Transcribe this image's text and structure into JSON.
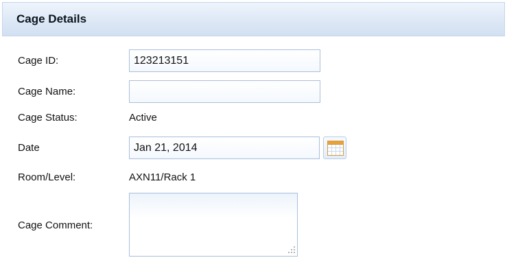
{
  "panel": {
    "title": "Cage Details"
  },
  "form": {
    "cage_id": {
      "label": "Cage ID:",
      "value": "123213151"
    },
    "cage_name": {
      "label": "Cage Name:",
      "value": ""
    },
    "cage_status": {
      "label": "Cage Status:",
      "value": "Active"
    },
    "date": {
      "label": "Date",
      "value": "Jan 21, 2014",
      "picker_icon": "calendar-icon"
    },
    "room_level": {
      "label": "Room/Level:",
      "value": "AXN11/Rack 1"
    },
    "cage_comment": {
      "label": "Cage Comment:",
      "value": "",
      "resize_icon": "resize-grip-icon"
    }
  },
  "colors": {
    "header_gradient_top": "#eef4fc",
    "header_gradient_bottom": "#d2e0f2",
    "field_border": "#a9bfda",
    "calendar_accent": "#e8a23a"
  }
}
